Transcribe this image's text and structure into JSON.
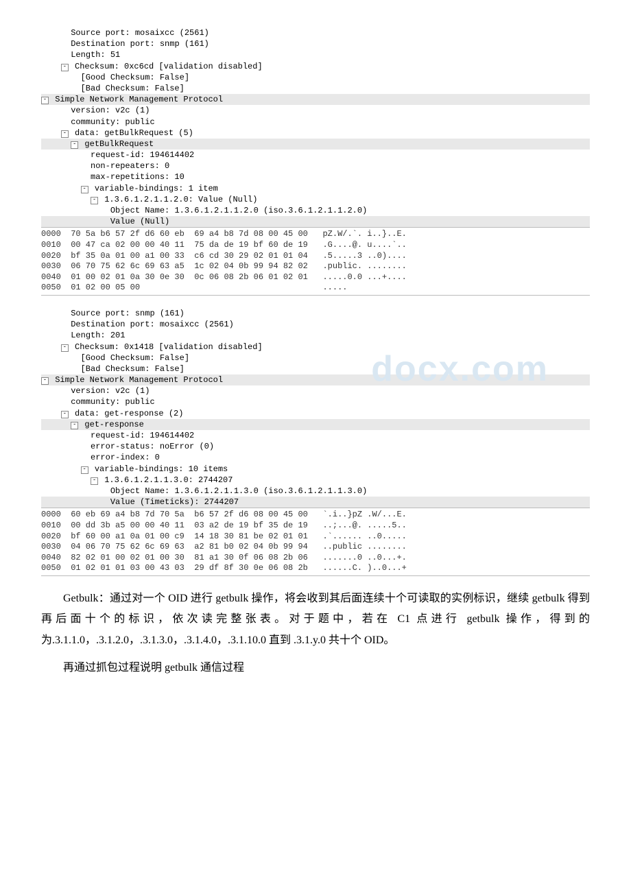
{
  "packet1": {
    "src_port": "Source port: mosaixcc (2561)",
    "dst_port": "Destination port: snmp (161)",
    "length": "Length: 51",
    "checksum": "Checksum: 0xc6cd [validation disabled]",
    "good_chk": "[Good Checksum: False]",
    "bad_chk": "[Bad Checksum: False]",
    "snmp_hdr": "Simple Network Management Protocol",
    "version": "version: v2c (1)",
    "community": "community: public",
    "data": "data: getBulkRequest (5)",
    "pdu": "getBulkRequest",
    "request_id": "request-id: 194614402",
    "non_repeaters": "non-repeaters: 0",
    "max_rep": "max-repetitions: 10",
    "varbind_hdr": "variable-bindings: 1 item",
    "oid_line": "1.3.6.1.2.1.1.2.0: Value (Null)",
    "obj_name": "Object Name: 1.3.6.1.2.1.1.2.0 (iso.3.6.1.2.1.1.2.0)",
    "value": "Value (Null)",
    "hex": "0000  70 5a b6 57 2f d6 60 eb  69 a4 b8 7d 08 00 45 00   pZ.W/.`. i..}..E.\n0010  00 47 ca 02 00 00 40 11  75 da de 19 bf 60 de 19   .G....@. u....`..\n0020  bf 35 0a 01 00 a1 00 33  c6 cd 30 29 02 01 01 04   .5.....3 ..0)....\n0030  06 70 75 62 6c 69 63 a5  1c 02 04 0b 99 94 82 02   .public. ........\n0040  01 00 02 01 0a 30 0e 30  0c 06 08 2b 06 01 02 01   .....0.0 ...+....\n0050  01 02 00 05 00                                     ....."
  },
  "packet2": {
    "src_port": "Source port: snmp (161)",
    "dst_port": "Destination port: mosaixcc (2561)",
    "length": "Length: 201",
    "checksum": "Checksum: 0x1418 [validation disabled]",
    "good_chk": "[Good Checksum: False]",
    "bad_chk": "[Bad Checksum: False]",
    "snmp_hdr": "Simple Network Management Protocol",
    "version": "version: v2c (1)",
    "community": "community: public",
    "data": "data: get-response (2)",
    "pdu": "get-response",
    "request_id": "request-id: 194614402",
    "error_status": "error-status: noError (0)",
    "error_index": "error-index: 0",
    "varbind_hdr": "variable-bindings: 10 items",
    "oid_line": "1.3.6.1.2.1.1.3.0: 2744207",
    "obj_name": "Object Name: 1.3.6.1.2.1.1.3.0 (iso.3.6.1.2.1.1.3.0)",
    "value": "Value (Timeticks): 2744207",
    "hex": "0000  60 eb 69 a4 b8 7d 70 5a  b6 57 2f d6 08 00 45 00   `.i..}pZ .W/...E.\n0010  00 dd 3b a5 00 00 40 11  03 a2 de 19 bf 35 de 19   ..;...@. .....5..\n0020  bf 60 00 a1 0a 01 00 c9  14 18 30 81 be 02 01 01   .`...... ..0.....\n0030  04 06 70 75 62 6c 69 63  a2 81 b0 02 04 0b 99 94   ..public ........\n0040  82 02 01 00 02 01 00 30  81 a1 30 0f 06 08 2b 06   .......0 ..0...+.\n0050  01 02 01 01 03 00 43 03  29 df 8f 30 0e 06 08 2b   ......C. )..0...+"
  },
  "prose": {
    "p1": "Getbulk：通过对一个 OID 进行 getbulk 操作，将会收到其后面连续十个可读取的实例标识，继续 getbulk 得到再后面十个的标识，依次读完整张表。对于题中，若在 C1 点进行 getbulk 操作，得到的为.3.1.1.0，.3.1.2.0，.3.1.3.0，.3.1.4.0，.3.1.10.0 直到 .3.1.y.0 共十个 OID。",
    "p2": "再通过抓包过程说明 getbulk 通信过程"
  }
}
